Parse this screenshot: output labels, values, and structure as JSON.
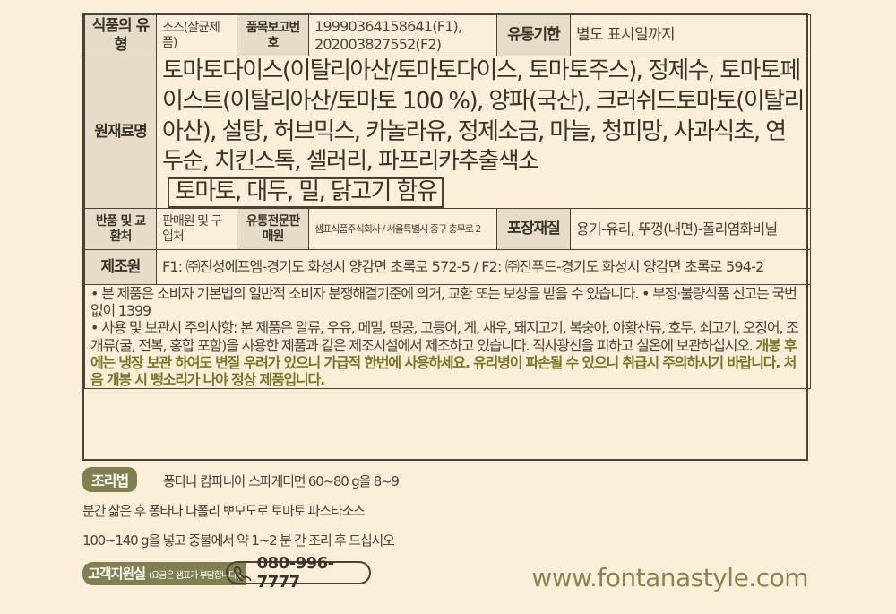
{
  "table": {
    "row1": {
      "type_label": "식품의 유형",
      "type_value": "소스(살균제품)",
      "report_label": "품목보고번호",
      "report_value": "19990364158641(F1), 202003827552(F2)",
      "expiry_label": "유통기한",
      "expiry_value": "별도 표시일까지"
    },
    "row2": {
      "ingredients_label": "원재료명",
      "ingredients_text": "토마토다이스(이탈리아산/토마토다이스, 토마토주스), 정제수, 토마토페이스트(이탈리아산/토마토 100 %), 양파(국산), 크러쉬드토마토(이탈리아산), 설탕, 허브믹스, 카놀라유, 정제소금, 마늘, 청피망, 사과식초, 연두순, 치킨스톡, 셀러리, 파프리카추출색소",
      "allergen": "토마토, 대두, 밀, 닭고기 함유"
    },
    "row3": {
      "exchange_label": "반품 및 교환처",
      "exchange_value": "판매원 및 구입처",
      "distributor_label": "유통전문판매원",
      "distributor_value": "샘표식품주식회사 / 서울특별시 중구 충무로 2",
      "packaging_label": "포장재질",
      "packaging_value": "용기-유리, 뚜껑(내면)-폴리염화비닐"
    },
    "row4": {
      "maker_label": "제조원",
      "maker_value": "F1: ㈜진성에프엠-경기도 화성시 양감면 초록로 572-5 / F2: ㈜진푸드-경기도 화성시 양감면 초록로 594-2"
    },
    "notice": {
      "line1": "• 본 제품은 소비자 기본법의 일반적 소비자 분쟁해결기준에 의거, 교환 또는 보상을 받을 수 있습니다. • 부정·불량식품 신고는 국번없이 1399",
      "line2": "• 사용 및 보관시 주의사항: 본 제품은 알류, 우유, 메밀, 땅콩, 고등어, 게, 새우, 돼지고기, 복숭아, 아황산류, 호두, 쇠고기, 오징어, 조개류(굴, 전복, 홍합 포함)을 사용한 제품과 같은 제조시설에서 제조하고 있습니다. 직사광선을 피하고 실온에 보관하십시오.",
      "warning": "개봉 후에는 냉장 보관 하여도 변질 우려가 있으니 가급적 한번에 사용하세요. 유리병이 파손될 수 있으니 취급시 주의하시기 바랍니다. 처음 개봉 시 뻥소리가 나야 정상 제품입니다."
    }
  },
  "cooking": {
    "badge": "조리법",
    "text": "퐁타나 캄파니아 스파게티면 60~80 g을 8~9 분간 삶은 후 퐁타나 나폴리 뽀모도로 토마토 파스타소스 100~140 g을 넣고 중불에서 약 1~2 분 간 조리 후 드십시오 (1인분 기준)"
  },
  "support": {
    "label": "고객지원실",
    "note": "(요금은 샘표가 부담합니다.)",
    "phone": "080-996-7777",
    "icon": "phone-icon"
  },
  "website": "www.fontanastyle.com",
  "colors": {
    "background": "#fbefd9",
    "header_cell": "#e6dcc7",
    "badge": "#7f7f50",
    "warning_text": "#7d7429"
  }
}
